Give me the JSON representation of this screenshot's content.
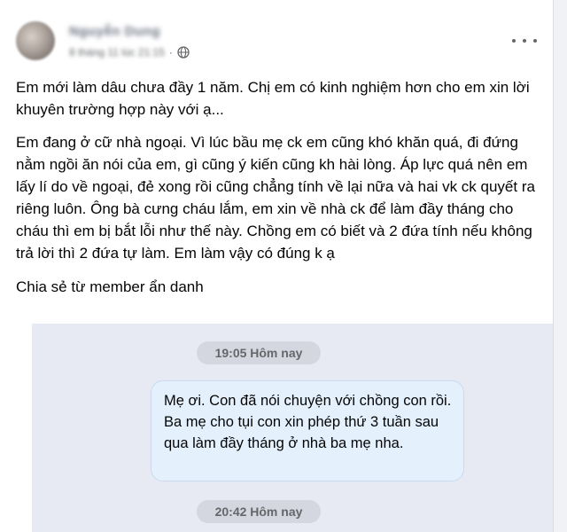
{
  "post": {
    "author": "Nguyễn Dung",
    "date": "8 tháng 11 lúc 21:15",
    "privacy_icon": "globe-icon",
    "more_icon": "more-options-icon",
    "paragraphs": [
      "Em mới làm dâu chưa đầy 1 năm. Chị em có kinh nghiệm hơn cho em xin lời khuyên trường hợp này với ạ...",
      "Em đang ở cữ nhà ngoại. Vì lúc bầu mẹ ck em cũng khó khăn quá, đi đứng nằm ngồi ăn nói của em, gì cũng ý kiến cũng kh hài lòng. Áp lực quá nên em lấy lí do về ngoại, đẻ xong rồi cũng chẳng tính về lại nữa và hai vk ck quyết ra riêng luôn. Ông bà cưng cháu lắm, em xin về nhà ck để làm đầy tháng cho cháu thì em bị bắt lỗi như thế này. Chồng em có biết và 2 đứa tính nếu không trả lời thì 2 đứa tự làm. Em làm vậy có đúng k ạ",
      "Chia sẻ từ member ẩn danh"
    ]
  },
  "screenshot": {
    "time_1": "19:05 Hôm nay",
    "message": "Mẹ ơi. Con đã nói chuyện với chồng con rồi. Ba mẹ cho tụi con xin phép thứ 3 tuần sau qua làm đầy tháng ở nhà ba mẹ nha.",
    "time_2": "20:42 Hôm nay"
  }
}
